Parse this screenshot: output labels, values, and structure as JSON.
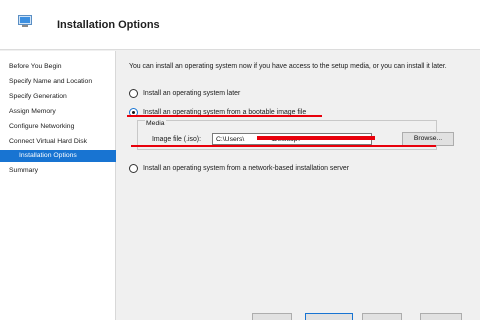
{
  "header": {
    "title": "Installation Options",
    "icon": "wizard-icon"
  },
  "sidebar": {
    "items": [
      {
        "label": "Before You Begin",
        "active": false
      },
      {
        "label": "Specify Name and Location",
        "active": false
      },
      {
        "label": "Specify Generation",
        "active": false
      },
      {
        "label": "Assign Memory",
        "active": false
      },
      {
        "label": "Configure Networking",
        "active": false
      },
      {
        "label": "Connect Virtual Hard Disk",
        "active": false
      },
      {
        "label": "Installation Options",
        "active": true
      },
      {
        "label": "Summary",
        "active": false
      }
    ]
  },
  "main": {
    "intro": "You can install an operating system now if you have access to the setup media, or you can install it later.",
    "options": [
      {
        "label": "Install an operating system later",
        "checked": false
      },
      {
        "label": "Install an operating system from a bootable image file",
        "checked": true
      },
      {
        "label": "Install an operating system from a network-based installation server",
        "checked": false
      }
    ],
    "media": {
      "legend": "Media",
      "image_file_label": "Image file (.iso):",
      "image_file_value": "C:\\Users\\              \\Desktop\\",
      "browse_label": "Browse..."
    }
  },
  "colors": {
    "accent": "#1874d2",
    "annotation_red": "#e8000b"
  }
}
